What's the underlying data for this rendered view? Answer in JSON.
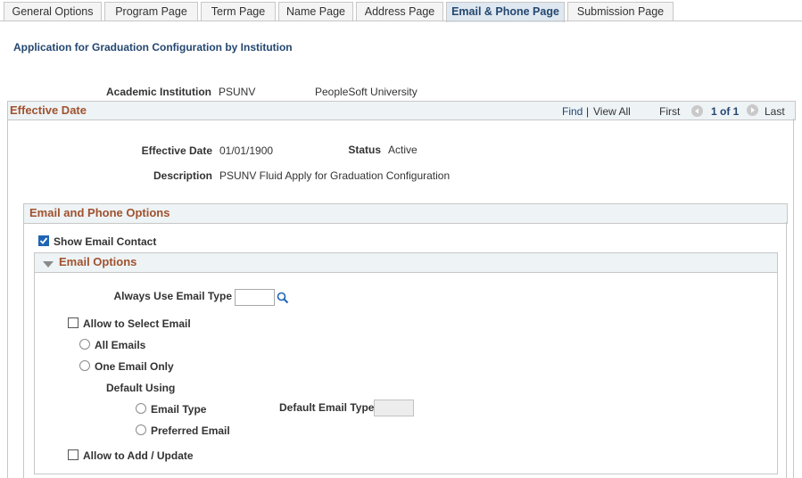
{
  "tabs": [
    {
      "label": "General Options"
    },
    {
      "label": "Program Page"
    },
    {
      "label": "Term Page"
    },
    {
      "label": "Name Page"
    },
    {
      "label": "Address Page"
    },
    {
      "label": "Email & Phone Page"
    },
    {
      "label": "Submission Page"
    }
  ],
  "active_tab_index": 5,
  "page_title": "Application for Graduation Configuration by Institution",
  "institution": {
    "label": "Academic Institution",
    "code": "PSUNV",
    "name": "PeopleSoft University"
  },
  "effective_date_section": {
    "title": "Effective Date",
    "find": "Find",
    "separator": "|",
    "view_all": "View All",
    "first": "First",
    "count": "1 of 1",
    "last": "Last",
    "effective_date_label": "Effective Date",
    "effective_date_value": "01/01/1900",
    "status_label": "Status",
    "status_value": "Active",
    "description_label": "Description",
    "description_value": "PSUNV Fluid Apply for Graduation Configuration"
  },
  "email_phone_section": {
    "title": "Email and Phone Options",
    "show_email_contact": {
      "label": "Show Email Contact",
      "checked": true
    }
  },
  "email_options": {
    "title": "Email Options",
    "always_use_label": "Always Use Email Type",
    "always_use_value": "",
    "allow_select": {
      "label": "Allow to Select Email",
      "checked": false
    },
    "all_emails": "All Emails",
    "one_email_only": "One Email Only",
    "default_using": "Default Using",
    "email_type": "Email Type",
    "preferred_email": "Preferred Email",
    "default_email_type_label": "Default Email Type",
    "default_email_type_value": "",
    "allow_add_update": {
      "label": "Allow to Add / Update",
      "checked": false
    }
  },
  "colors": {
    "link": "#244770",
    "section_title": "#a0522d",
    "checkbox_on": "#1e64b4"
  }
}
